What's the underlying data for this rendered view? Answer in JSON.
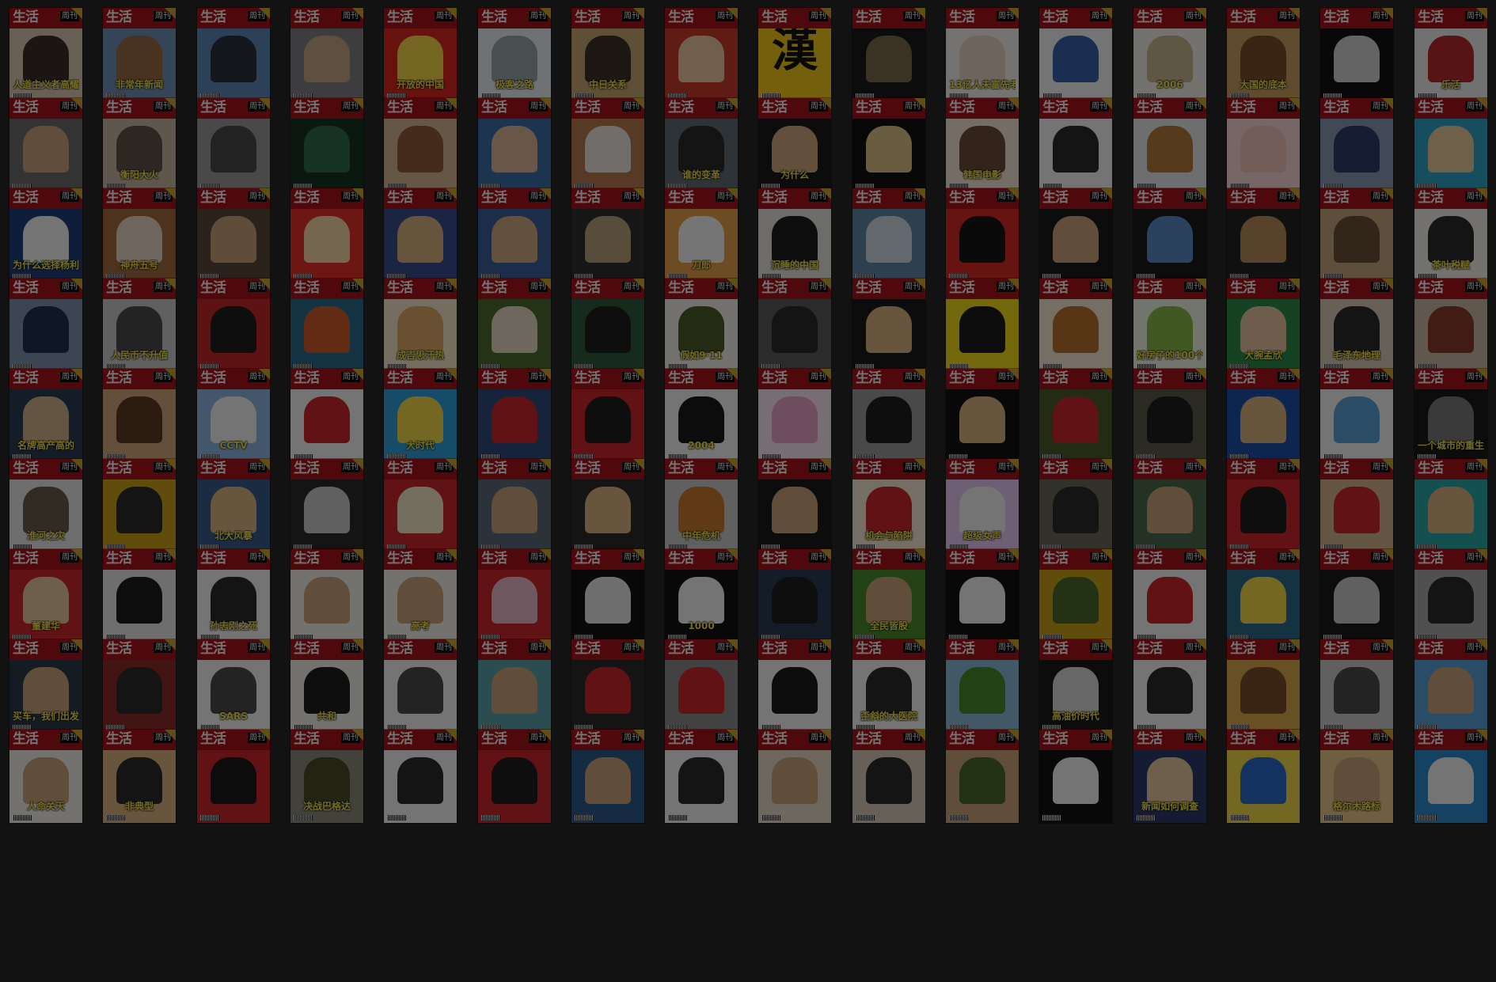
{
  "covers": [
    {
      "headline": "人道主义者高耀洁",
      "bg": "#d9c9b0",
      "fig": "#3a2f28"
    },
    {
      "headline": "非常年新闻",
      "bg": "#6f8fb5",
      "fig": "#9b6a44"
    },
    {
      "headline": "",
      "bg": "#5d86b8",
      "fig": "#2d3140"
    },
    {
      "headline": "",
      "bg": "#7f7f86",
      "fig": "#c6a583"
    },
    {
      "headline": "开放的中国",
      "bg": "#d8271f",
      "fig": "#f3d34a"
    },
    {
      "headline": "极客之路",
      "bg": "#e9eef2",
      "fig": "#9aa3a8"
    },
    {
      "headline": "中日关系",
      "bg": "#c4a574",
      "fig": "#3b3027"
    },
    {
      "headline": "",
      "bg": "#c43b2c",
      "fig": "#e9c6a0"
    },
    {
      "headline": "",
      "big": "漢",
      "bg": "#f0c61a",
      "fig": "#f0c61a"
    },
    {
      "headline": "",
      "bg": "#1a1a1a",
      "fig": "#7a6a4a"
    },
    {
      "headline": "13亿人未富先老",
      "bg": "#f4f1ee",
      "fig": "#e6d2bf"
    },
    {
      "headline": "",
      "bg": "#f2f2f2",
      "fig": "#3560a8"
    },
    {
      "headline": "2006",
      "bg": "#f2efe8",
      "fig": "#c6b48c"
    },
    {
      "headline": "大国的底本",
      "bg": "#c69f63",
      "fig": "#7a4e2a"
    },
    {
      "headline": "",
      "bg": "#111111",
      "fig": "#d2d2d2"
    },
    {
      "headline": "乐活",
      "bg": "#ececec",
      "fig": "#b8282a"
    },
    {
      "headline": "",
      "bg": "#6b6b6b",
      "fig": "#caa27c"
    },
    {
      "headline": "衡阳大火",
      "bg": "#c6b7a3",
      "fig": "#5e5247"
    },
    {
      "headline": "",
      "bg": "#9a9a9a",
      "fig": "#4a4a4a"
    },
    {
      "headline": "",
      "bg": "#153222",
      "fig": "#2f6e45"
    },
    {
      "headline": "",
      "bg": "#d6b392",
      "fig": "#8e5a3a"
    },
    {
      "headline": "",
      "bg": "#3e6ea8",
      "fig": "#d9b792"
    },
    {
      "headline": "",
      "bg": "#b57a4f",
      "fig": "#ebe4df"
    },
    {
      "headline": "谁的变革",
      "bg": "#5f6b73",
      "fig": "#2b2b2b"
    },
    {
      "headline": "为什么",
      "bg": "#1a1a1a",
      "fig": "#cfa77d"
    },
    {
      "headline": "",
      "bg": "#111111",
      "fig": "#d9c089"
    },
    {
      "headline": "韩国电影",
      "bg": "#f2e4d4",
      "fig": "#6b4b3a"
    },
    {
      "headline": "",
      "bg": "#f2f2f2",
      "fig": "#2a2a2a"
    },
    {
      "headline": "",
      "bg": "#e3e6ea",
      "fig": "#b17a3a"
    },
    {
      "headline": "",
      "bg": "#f6d7d6",
      "fig": "#f0c3b8"
    },
    {
      "headline": "",
      "bg": "#8a9ab3",
      "fig": "#2d3e6a"
    },
    {
      "headline": "",
      "bg": "#2ea3c8",
      "fig": "#e9c89a"
    },
    {
      "headline": "为什么选择杨利伟",
      "bg": "#1d3e7a",
      "fig": "#f2f2f2"
    },
    {
      "headline": "神舟五号",
      "bg": "#a26b3f",
      "fig": "#e6d5c0"
    },
    {
      "headline": "",
      "bg": "#5b4a3a",
      "fig": "#c79f78"
    },
    {
      "headline": "",
      "bg": "#e2302a",
      "fig": "#f4d7a5"
    },
    {
      "headline": "",
      "bg": "#3a4b8a",
      "fig": "#d8b07f"
    },
    {
      "headline": "",
      "bg": "#3c5f9a",
      "fig": "#cfa982"
    },
    {
      "headline": "",
      "bg": "#2f2f2f",
      "fig": "#b8a07a"
    },
    {
      "headline": "刀郎",
      "bg": "#e5a04a",
      "fig": "#f4f4f4"
    },
    {
      "headline": "沉睡的中国",
      "bg": "#e6e1d9",
      "fig": "#1f1f1f"
    },
    {
      "headline": "",
      "bg": "#5f87a8",
      "fig": "#cfd9e2"
    },
    {
      "headline": "",
      "bg": "#d32a26",
      "fig": "#151515"
    },
    {
      "headline": "",
      "bg": "#1a1a1a",
      "fig": "#c9a27c"
    },
    {
      "headline": "",
      "bg": "#1b1b1b",
      "fig": "#5a8ac4"
    },
    {
      "headline": "",
      "bg": "#232323",
      "fig": "#b88b5c"
    },
    {
      "headline": "",
      "bg": "#c4a57d",
      "fig": "#6a4e35"
    },
    {
      "headline": "茶叶税赋",
      "bg": "#f2efe9",
      "fig": "#2b2b2b"
    },
    {
      "headline": "",
      "bg": "#7e93ab",
      "fig": "#1f3050"
    },
    {
      "headline": "人民币不升值",
      "bg": "#c8c8c8",
      "fig": "#4a4a4a"
    },
    {
      "headline": "",
      "bg": "#c2262a",
      "fig": "#1f1f1f"
    },
    {
      "headline": "",
      "bg": "#2a6b8a",
      "fig": "#cf5a2a"
    },
    {
      "headline": "成吉思汗热",
      "bg": "#f2e4c8",
      "fig": "#d9a866"
    },
    {
      "headline": "",
      "bg": "#4b6b2f",
      "fig": "#e6d8c2"
    },
    {
      "headline": "",
      "bg": "#2f5a3a",
      "fig": "#1f1f1f"
    },
    {
      "headline": "假如9·11",
      "bg": "#f2efe8",
      "fig": "#4a5a2a"
    },
    {
      "headline": "",
      "bg": "#5a5a5a",
      "fig": "#2a2a2a"
    },
    {
      "headline": "",
      "bg": "#1a1a1a",
      "fig": "#d8b182"
    },
    {
      "headline": "",
      "bg": "#f0dc1a",
      "fig": "#1a1a1a"
    },
    {
      "headline": "",
      "bg": "#f2e6d3",
      "fig": "#b8702a"
    },
    {
      "headline": "好房子的100个细节",
      "bg": "#eef2e6",
      "fig": "#8ab84a"
    },
    {
      "headline": "大腕孟欣",
      "bg": "#2a8a4a",
      "fig": "#e6c3a1"
    },
    {
      "headline": "毛泽东地理",
      "bg": "#d8c9b5",
      "fig": "#2b2b2b"
    },
    {
      "headline": "",
      "bg": "#c9b8a6",
      "fig": "#8a3a2a"
    },
    {
      "headline": "名牌高产高的",
      "bg": "#2a3b55",
      "fig": "#d2b08a"
    },
    {
      "headline": "",
      "bg": "#d2a77a",
      "fig": "#5a3a22"
    },
    {
      "headline": "CCTV",
      "bg": "#8fb5e0",
      "fig": "#f2f2f2"
    },
    {
      "headline": "",
      "bg": "#f2f2f2",
      "fig": "#c8262a"
    },
    {
      "headline": "大时代",
      "bg": "#2ea0d8",
      "fig": "#f2d84a"
    },
    {
      "headline": "",
      "bg": "#2f4a7a",
      "fig": "#c8262a"
    },
    {
      "headline": "",
      "bg": "#c8262a",
      "fig": "#1f1f1f"
    },
    {
      "headline": "2004",
      "bg": "#f2f2f2",
      "fig": "#1a1a1a"
    },
    {
      "headline": "",
      "bg": "#f6e7ef",
      "fig": "#e6a2c4"
    },
    {
      "headline": "",
      "bg": "#9a9a9a",
      "fig": "#1f1f1f"
    },
    {
      "headline": "",
      "bg": "#111111",
      "fig": "#d8b182"
    },
    {
      "headline": "",
      "bg": "#4a5a2a",
      "fig": "#c8262a"
    },
    {
      "headline": "",
      "bg": "#5a5a4a",
      "fig": "#1f1f1f"
    },
    {
      "headline": "",
      "bg": "#1f4fa8",
      "fig": "#d8b182"
    },
    {
      "headline": "",
      "bg": "#f2f2f2",
      "fig": "#5aa0d8"
    },
    {
      "headline": "一个城市的重生",
      "bg": "#1a1a1a",
      "fig": "#7a7a7a"
    },
    {
      "headline": "淮河之灾",
      "bg": "#e6e6e6",
      "fig": "#6a5a4a"
    },
    {
      "headline": "",
      "bg": "#c8a21a",
      "fig": "#2b2b2b"
    },
    {
      "headline": "北大风暴",
      "bg": "#3a5a8a",
      "fig": "#d8b182"
    },
    {
      "headline": "",
      "bg": "#2a2a2a",
      "fig": "#c8c8c8"
    },
    {
      "headline": "",
      "bg": "#c8262a",
      "fig": "#f2e6c8"
    },
    {
      "headline": "",
      "bg": "#5a6a7a",
      "fig": "#c8a27a"
    },
    {
      "headline": "",
      "bg": "#2a2a2a",
      "fig": "#d8b182"
    },
    {
      "headline": "中年危机",
      "bg": "#c8c8c8",
      "fig": "#c87a2a"
    },
    {
      "headline": "",
      "bg": "#1a1a1a",
      "fig": "#c8a27a"
    },
    {
      "headline": "机会与陷阱",
      "bg": "#f2e6d3",
      "fig": "#c8262a"
    },
    {
      "headline": "超级女声",
      "bg": "#e6c6f2",
      "fig": "#f2f2f2"
    },
    {
      "headline": "",
      "bg": "#6a6a5a",
      "fig": "#2a2a2a"
    },
    {
      "headline": "",
      "bg": "#4a6a4a",
      "fig": "#c8a27a"
    },
    {
      "headline": "",
      "bg": "#c8262a",
      "fig": "#1f1f1f"
    },
    {
      "headline": "",
      "bg": "#d2b48a",
      "fig": "#c8262a"
    },
    {
      "headline": "",
      "bg": "#2aa8a8",
      "fig": "#d8b182"
    },
    {
      "headline": "董建华",
      "bg": "#c8262a",
      "fig": "#e6c6a0"
    },
    {
      "headline": "",
      "bg": "#e6e6e6",
      "fig": "#1f1f1f"
    },
    {
      "headline": "孙志刚之死",
      "bg": "#f2f2f2",
      "fig": "#2b2b2b"
    },
    {
      "headline": "",
      "bg": "#f2efe8",
      "fig": "#c8a27a"
    },
    {
      "headline": "高考",
      "bg": "#f2efe8",
      "fig": "#c8a27a"
    },
    {
      "headline": "",
      "bg": "#c8262a",
      "fig": "#e6b6c6"
    },
    {
      "headline": "",
      "bg": "#111111",
      "fig": "#e6e6e6"
    },
    {
      "headline": "1000",
      "bg": "#111111",
      "fig": "#f2f2f2"
    },
    {
      "headline": "",
      "bg": "#2a3b55",
      "fig": "#1f1f1f"
    },
    {
      "headline": "全民皆股",
      "bg": "#4a8a2a",
      "fig": "#c8a27a"
    },
    {
      "headline": "",
      "bg": "#111111",
      "fig": "#f2f2f2"
    },
    {
      "headline": "",
      "bg": "#c8a21a",
      "fig": "#4a6a2a"
    },
    {
      "headline": "",
      "bg": "#f2f2f2",
      "fig": "#c8262a"
    },
    {
      "headline": "",
      "bg": "#2a6a8a",
      "fig": "#f2d84a"
    },
    {
      "headline": "",
      "bg": "#1a1a1a",
      "fig": "#c8c8c8"
    },
    {
      "headline": "",
      "bg": "#a8a8a8",
      "fig": "#2b2b2b"
    },
    {
      "headline": "买车，我们出发",
      "bg": "#2a3a4a",
      "fig": "#c8a27a"
    },
    {
      "headline": "",
      "bg": "#8a2a2a",
      "fig": "#2b2b2b"
    },
    {
      "headline": "SARS",
      "bg": "#f2f2f2",
      "fig": "#4a4a4a"
    },
    {
      "headline": "共和",
      "bg": "#f2efe8",
      "fig": "#1f1f1f"
    },
    {
      "headline": "",
      "bg": "#f2f2f2",
      "fig": "#4a4a4a"
    },
    {
      "headline": "",
      "bg": "#5aa0a8",
      "fig": "#c8a27a"
    },
    {
      "headline": "",
      "bg": "#2a2a2a",
      "fig": "#c8262a"
    },
    {
      "headline": "",
      "bg": "#8a8a8a",
      "fig": "#c8262a"
    },
    {
      "headline": "",
      "bg": "#f2f2f2",
      "fig": "#1a1a1a"
    },
    {
      "headline": "歪斜的大医院",
      "bg": "#f2f2f2",
      "fig": "#2b2b2b"
    },
    {
      "headline": "",
      "bg": "#8ab8d8",
      "fig": "#4a8a2a"
    },
    {
      "headline": "高油价时代",
      "bg": "#1a1a1a",
      "fig": "#d8d8d8"
    },
    {
      "headline": "",
      "bg": "#f2f2f2",
      "fig": "#2b2b2b"
    },
    {
      "headline": "",
      "bg": "#d8a84a",
      "fig": "#7a4e2a"
    },
    {
      "headline": "",
      "bg": "#c8c8c8",
      "fig": "#4a4a4a"
    },
    {
      "headline": "",
      "bg": "#5aa0d8",
      "fig": "#c8a27a"
    },
    {
      "headline": "人命关天",
      "bg": "#f2efe8",
      "fig": "#c8a27a"
    },
    {
      "headline": "非典型",
      "bg": "#d8b182",
      "fig": "#2b2b2b"
    },
    {
      "headline": "",
      "bg": "#c8262a",
      "fig": "#1a1a1a"
    },
    {
      "headline": "决战巴格达",
      "bg": "#8a8a7a",
      "fig": "#4a4a2a"
    },
    {
      "headline": "",
      "bg": "#f2f2f2",
      "fig": "#2b2b2b"
    },
    {
      "headline": "",
      "bg": "#c8262a",
      "fig": "#1f1f1f"
    },
    {
      "headline": "",
      "bg": "#2a5a8a",
      "fig": "#c8a27a"
    },
    {
      "headline": "",
      "bg": "#f2f2f2",
      "fig": "#2b2b2b"
    },
    {
      "headline": "",
      "bg": "#e6d8c2",
      "fig": "#c8a27a"
    },
    {
      "headline": "",
      "bg": "#d8c8b8",
      "fig": "#2b2b2b"
    },
    {
      "headline": "",
      "bg": "#c8a27a",
      "fig": "#4a6a2a"
    },
    {
      "headline": "",
      "bg": "#111111",
      "fig": "#f2f2f2"
    },
    {
      "headline": "新闻如何调查",
      "bg": "#2a3a6a",
      "fig": "#e6c6a0"
    },
    {
      "headline": "",
      "bg": "#f2d84a",
      "fig": "#2a6ac8"
    },
    {
      "headline": "格尔木路标",
      "bg": "#e6c68a",
      "fig": "#c8a27a"
    },
    {
      "headline": "",
      "bg": "#2a8ac8",
      "fig": "#f2f2f2"
    }
  ],
  "mast": {
    "logo": "生活",
    "sub": "周刊"
  }
}
